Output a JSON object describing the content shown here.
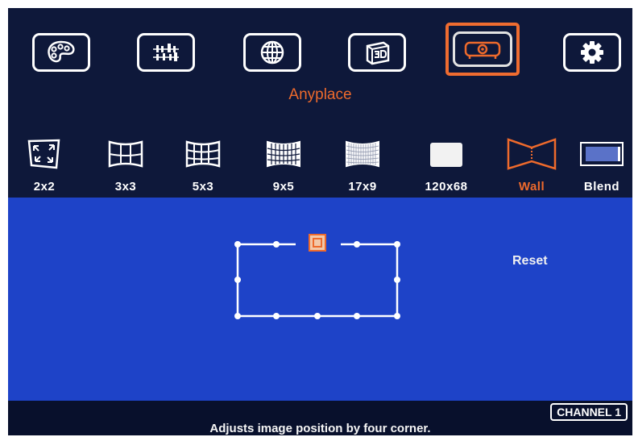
{
  "colors": {
    "accent": "#ee6a2c",
    "main_bg": "#1e43c8",
    "top_bg": "#0e183a",
    "text": "#ffffff"
  },
  "top_menu": {
    "items": [
      {
        "icon": "palette-icon",
        "selected": false
      },
      {
        "icon": "settings-sliders-icon",
        "selected": false
      },
      {
        "icon": "globe-icon",
        "selected": false
      },
      {
        "icon": "3d-icon",
        "selected": false
      },
      {
        "icon": "projector-icon",
        "selected": true
      },
      {
        "icon": "gear-icon",
        "selected": false
      }
    ]
  },
  "section_title": "Anyplace",
  "modes": [
    {
      "label": "2x2",
      "icon": "corner-adjust-icon"
    },
    {
      "label": "3x3",
      "icon": "curved-grid-3x3-icon"
    },
    {
      "label": "5x3",
      "icon": "curved-grid-5x3-icon"
    },
    {
      "label": "9x5",
      "icon": "curved-grid-9x5-icon"
    },
    {
      "label": "17x9",
      "icon": "curved-grid-17x9-icon"
    },
    {
      "label": "120x68",
      "icon": "dense-grid-icon"
    },
    {
      "label": "Wall",
      "icon": "wall-corner-icon",
      "selected": true
    },
    {
      "label": "Blend",
      "icon": "blend-icon"
    }
  ],
  "reset_label": "Reset",
  "hint": "Adjusts image position by four corner.",
  "channel": "CHANNEL 1"
}
